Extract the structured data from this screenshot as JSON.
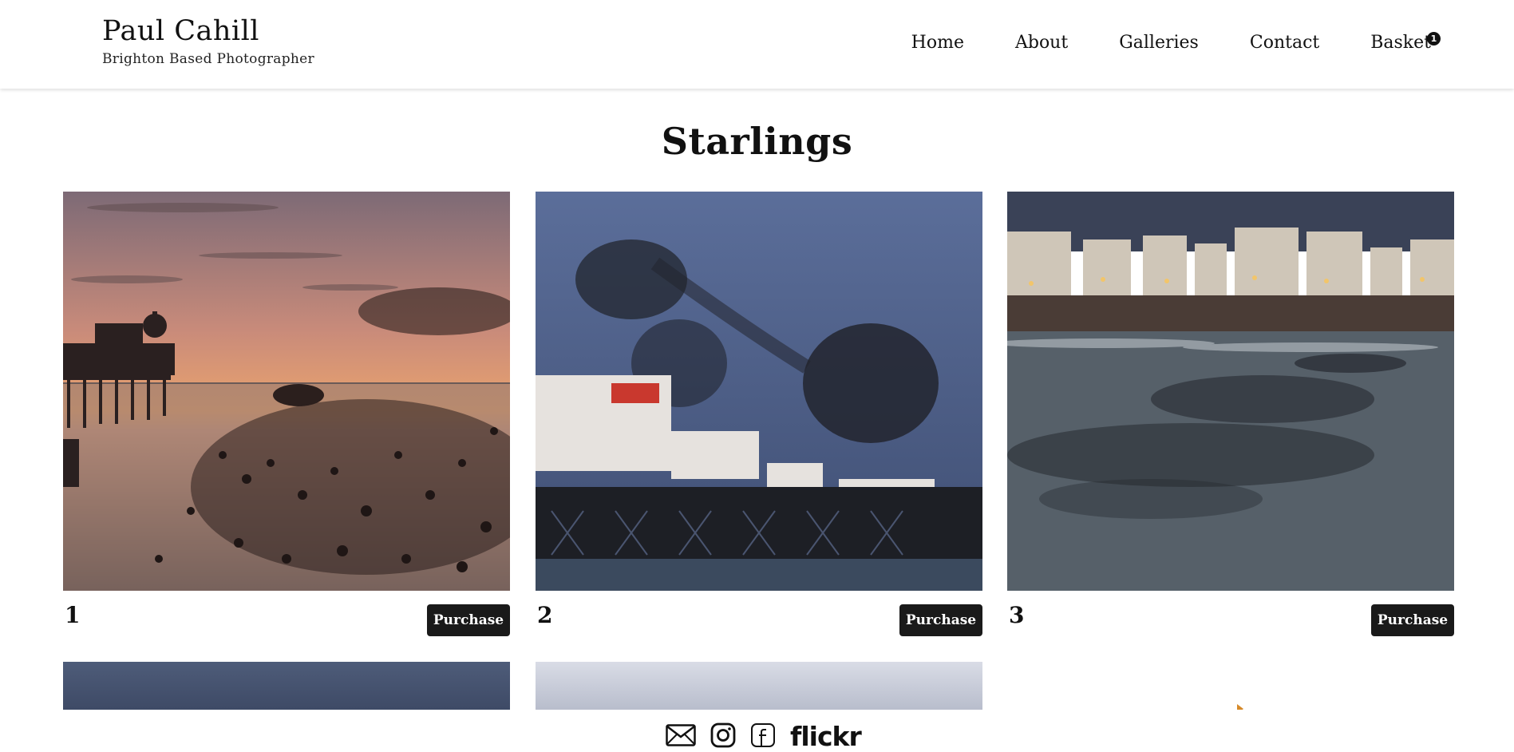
{
  "brand": {
    "name": "Paul Cahill",
    "tagline": "Brighton Based Photographer"
  },
  "nav": {
    "items": [
      "Home",
      "About",
      "Galleries",
      "Contact",
      "Basket"
    ],
    "basket_count": "1"
  },
  "page": {
    "title": "Starlings"
  },
  "gallery": {
    "items": [
      {
        "number": "1",
        "button": "Purchase"
      },
      {
        "number": "2",
        "button": "Purchase"
      },
      {
        "number": "3",
        "button": "Purchase"
      }
    ]
  },
  "footer": {
    "icons": [
      "mail-icon",
      "instagram-icon",
      "facebook-icon",
      "flickr-logo"
    ],
    "flickr_label": "flickr"
  },
  "colors": {
    "button_bg": "#1a1a1a",
    "text": "#111111",
    "background": "#ffffff"
  }
}
